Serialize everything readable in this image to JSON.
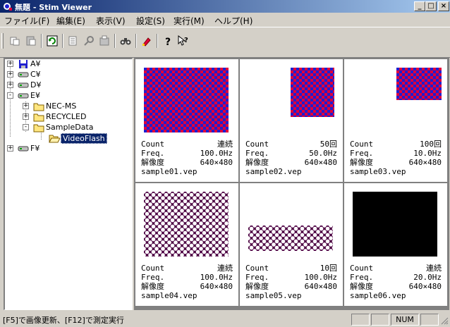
{
  "window": {
    "title": "無題 - Stim Viewer"
  },
  "menu": [
    "ファイル(F)",
    "編集(E)",
    "表示(V)",
    "設定(S)",
    "実行(M)",
    "ヘルプ(H)"
  ],
  "toolbar": {
    "buttons": [
      "cut-icon",
      "paste-icon",
      "refresh-icon",
      "list-view-icon",
      "find-icon",
      "properties-icon",
      "binoculars-icon",
      "paint-icon",
      "help-icon",
      "context-help-icon"
    ]
  },
  "tree": [
    {
      "label": "A¥",
      "icon": "floppy-drive-icon",
      "expander": "+"
    },
    {
      "label": "C¥",
      "icon": "hard-drive-icon",
      "expander": "+"
    },
    {
      "label": "D¥",
      "icon": "hard-drive-icon",
      "expander": "+"
    },
    {
      "label": "E¥",
      "icon": "hard-drive-icon",
      "expander": "-"
    },
    {
      "label": "NEC-MS",
      "icon": "folder-icon",
      "expander": "+"
    },
    {
      "label": "RECYCLED",
      "icon": "folder-icon",
      "expander": "+"
    },
    {
      "label": "SampleData",
      "icon": "folder-icon",
      "expander": "-"
    },
    {
      "label": "VideoFlash",
      "icon": "open-folder-icon",
      "expander": "",
      "selected": true
    },
    {
      "label": "F¥",
      "icon": "hard-drive-icon",
      "expander": "+"
    }
  ],
  "info_labels": {
    "count": "Count",
    "freq": "Freq.",
    "resolution": "解像度"
  },
  "stimuli": [
    {
      "count": "連続",
      "freq": "100.0Hz",
      "resolution": "640×480",
      "file": "sample01.vep",
      "pattern": "checkerboard",
      "preview_fraction": 1.0
    },
    {
      "count": "50回",
      "freq": "50.0Hz",
      "resolution": "640×480",
      "file": "sample02.vep",
      "pattern": "checkerboard",
      "preview_fraction": 0.5
    },
    {
      "count": "100回",
      "freq": "10.0Hz",
      "resolution": "640×480",
      "file": "sample03.vep",
      "pattern": "checkerboard",
      "preview_fraction": 0.45
    },
    {
      "count": "連続",
      "freq": "100.0Hz",
      "resolution": "640×480",
      "file": "sample04.vep",
      "pattern": "dots",
      "preview_fraction": 1.0
    },
    {
      "count": "10回",
      "freq": "100.0Hz",
      "resolution": "640×480",
      "file": "sample05.vep",
      "pattern": "dots",
      "preview_fraction": 0.35
    },
    {
      "count": "連続",
      "freq": "20.0Hz",
      "resolution": "640×480",
      "file": "sample06.vep",
      "pattern": "black",
      "preview_fraction": 1.0
    }
  ],
  "status": {
    "message": "[F5]で画像更新、[F12]で測定実行",
    "num": "NUM"
  },
  "colors": {
    "titlebar_start": "#0a246a",
    "titlebar_end": "#a6caf0",
    "checker_blue": "#1f1fd0",
    "checker_red": "#e0003c",
    "dots_bg": "#4c0042"
  }
}
